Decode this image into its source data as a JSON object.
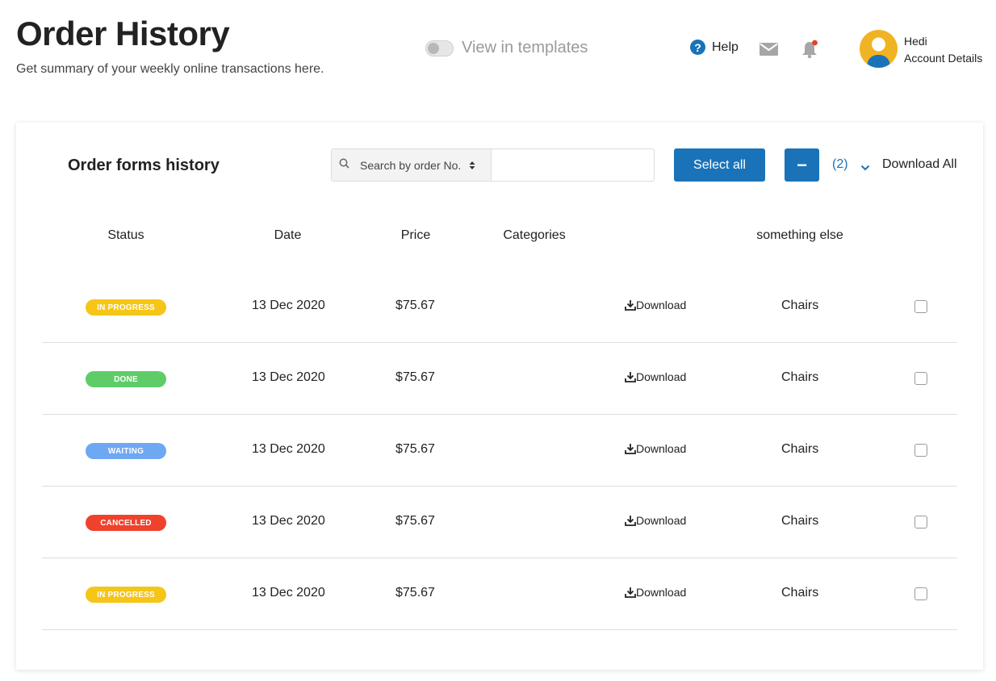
{
  "header": {
    "title": "Order History",
    "subtitle": "Get summary of your weekly online transactions here.",
    "toggle_label": "View in templates",
    "help_label": "Help",
    "user_name": "Hedi",
    "account_label": "Account Details"
  },
  "toolbar": {
    "section_title": "Order forms history",
    "search_select_label": "Search by order No.",
    "search_value": "",
    "select_all_label": "Select all",
    "minus_label": "−",
    "selected_count": "(2)",
    "download_all_label": "Download All"
  },
  "table": {
    "headers": [
      "Status",
      "Date",
      "Price",
      "Categories",
      "something else"
    ],
    "download_label": "Download",
    "rows": [
      {
        "status": "IN PROGRESS",
        "status_color": "#f5c518",
        "date": "13 Dec 2020",
        "price": "$75.67",
        "category": "Chairs"
      },
      {
        "status": "DONE",
        "status_color": "#5fcd67",
        "date": "13 Dec 2020",
        "price": "$75.67",
        "category": "Chairs"
      },
      {
        "status": "WAITING",
        "status_color": "#6ea8f2",
        "date": "13 Dec 2020",
        "price": "$75.67",
        "category": "Chairs"
      },
      {
        "status": "CANCELLED",
        "status_color": "#f0412c",
        "date": "13 Dec 2020",
        "price": "$75.67",
        "category": "Chairs"
      },
      {
        "status": "IN PROGRESS",
        "status_color": "#f5c518",
        "date": "13 Dec 2020",
        "price": "$75.67",
        "category": "Chairs"
      }
    ]
  },
  "colors": {
    "accent": "#1a73b8",
    "notification_dot": "#e0442a",
    "avatar_bg": "#f0b323"
  },
  "icons": {
    "help": "help-circle-icon",
    "mail": "mail-icon",
    "bell": "bell-icon",
    "search": "search-icon",
    "download": "download-icon",
    "chevron": "chevron-down-icon"
  }
}
